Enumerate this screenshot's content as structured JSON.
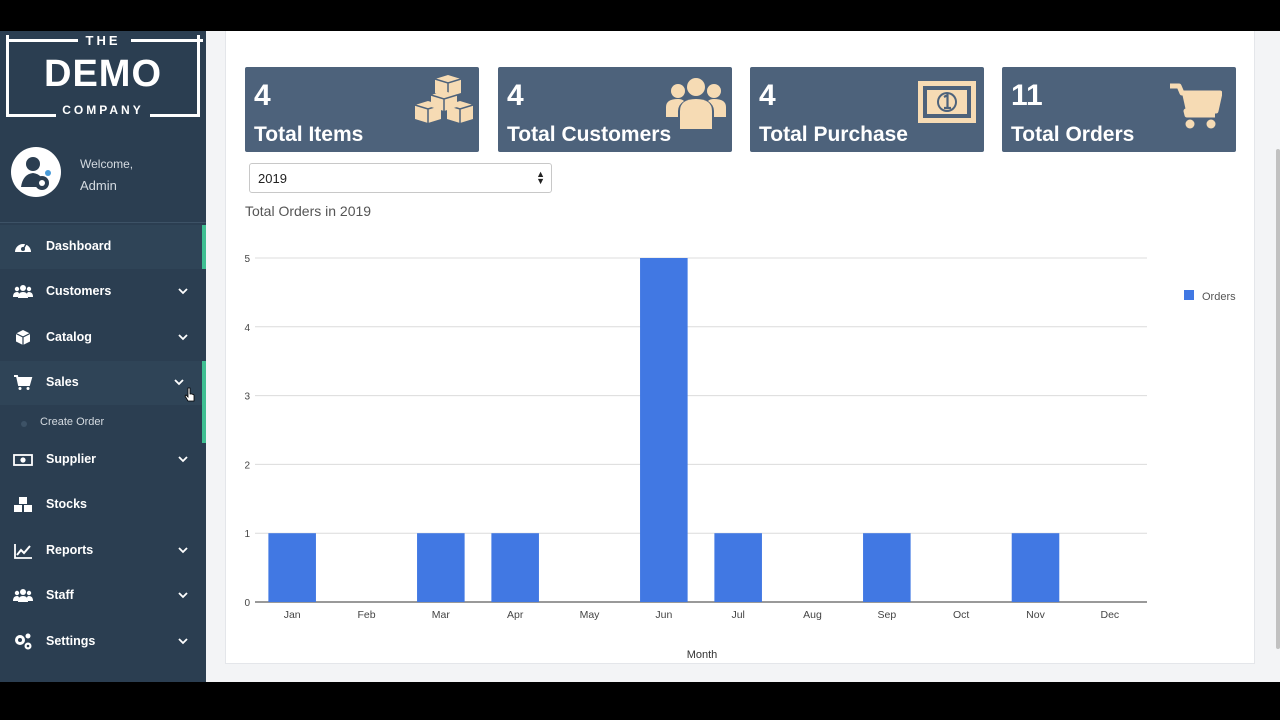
{
  "logo": {
    "the": "THE",
    "demo": "DEMO",
    "company": "COMPANY"
  },
  "user": {
    "welcome": "Welcome,",
    "name": "Admin"
  },
  "nav": {
    "dashboard": "Dashboard",
    "customers": "Customers",
    "catalog": "Catalog",
    "sales": "Sales",
    "create_order": "Create Order",
    "supplier": "Supplier",
    "stocks": "Stocks",
    "reports": "Reports",
    "staff": "Staff",
    "settings": "Settings"
  },
  "cards": [
    {
      "value": "4",
      "label": "Total Items",
      "icon": "cubes-icon"
    },
    {
      "value": "4",
      "label": "Total Customers",
      "icon": "users-icon"
    },
    {
      "value": "4",
      "label": "Total Purchase",
      "icon": "money-icon"
    },
    {
      "value": "11",
      "label": "Total Orders",
      "icon": "cart-icon"
    }
  ],
  "year_select": {
    "selected": "2019"
  },
  "chart_title": "Total Orders in 2019",
  "colors": {
    "sidebar": "#2b3e51",
    "card": "#4d627b",
    "bar": "#4178e3",
    "active_bar": "#3fbf92",
    "icon_accent": "#f6dbb4"
  },
  "chart_data": {
    "type": "bar",
    "categories": [
      "Jan",
      "Feb",
      "Mar",
      "Apr",
      "May",
      "Jun",
      "Jul",
      "Aug",
      "Sep",
      "Oct",
      "Nov",
      "Dec"
    ],
    "series": [
      {
        "name": "Orders",
        "values": [
          1,
          0,
          1,
          1,
          0,
          5,
          1,
          0,
          1,
          0,
          1,
          0
        ]
      }
    ],
    "xlabel": "Month",
    "ylabel": "",
    "ylim": [
      0,
      5
    ],
    "yticks": [
      "0",
      "1",
      "2",
      "3",
      "4",
      "5"
    ],
    "grid": true,
    "legend": "right"
  }
}
